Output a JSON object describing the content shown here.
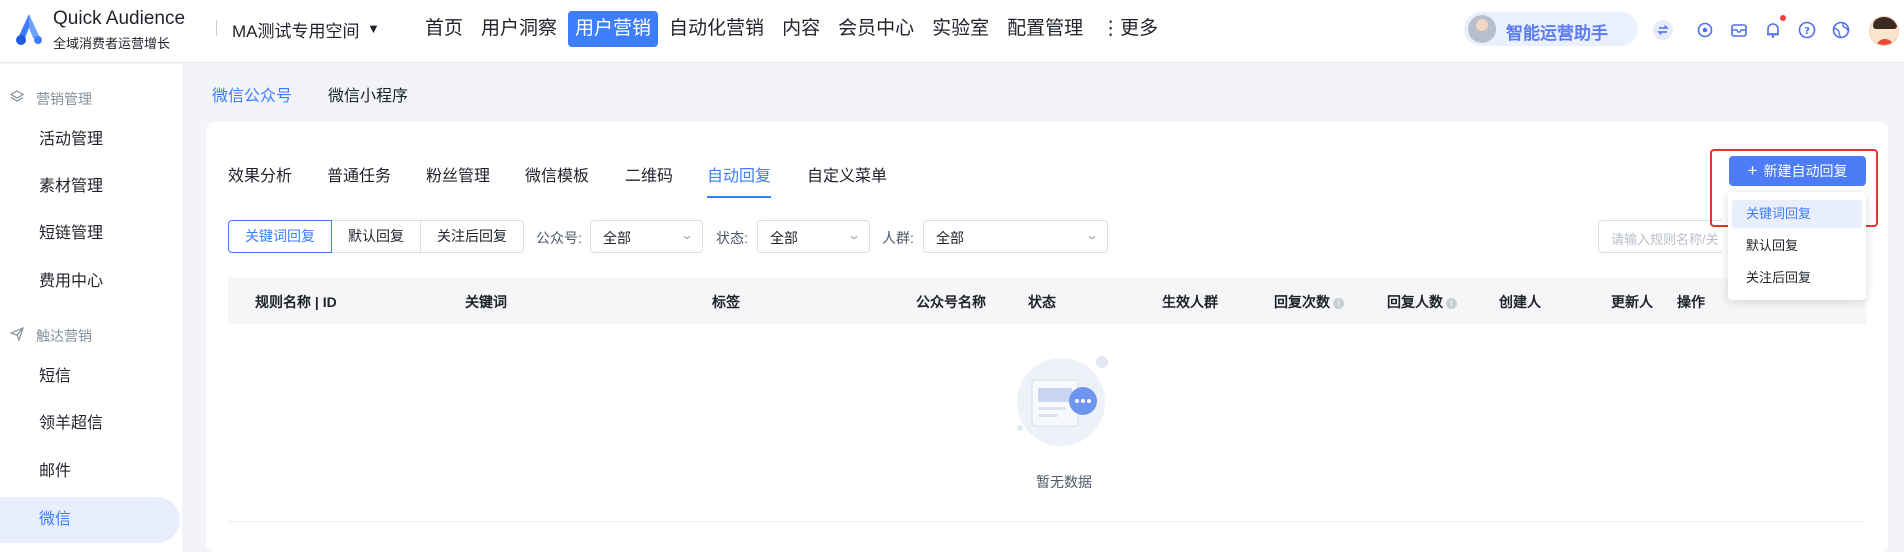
{
  "app": {
    "brand_name": "Quick Audience",
    "brand_subtitle": "全域消费者运营增长",
    "workspace": "MA测试专用空间"
  },
  "nav": {
    "items": [
      {
        "label": "首页",
        "active": false
      },
      {
        "label": "用户洞察",
        "active": false
      },
      {
        "label": "用户营销",
        "active": true
      },
      {
        "label": "自动化营销",
        "active": false
      },
      {
        "label": "内容",
        "active": false
      },
      {
        "label": "会员中心",
        "active": false
      },
      {
        "label": "实验室",
        "active": false
      },
      {
        "label": "配置管理",
        "active": false
      },
      {
        "label": "⋮更多",
        "active": false
      }
    ],
    "assistant_label": "智能运营助手"
  },
  "sidebar": {
    "groups": [
      {
        "label": "营销管理",
        "icon": "layers-icon"
      },
      {
        "label": "触达营销",
        "icon": "send-icon"
      }
    ],
    "items": [
      {
        "label": "活动管理"
      },
      {
        "label": "素材管理"
      },
      {
        "label": "短链管理"
      },
      {
        "label": "费用中心"
      },
      {
        "label": "短信"
      },
      {
        "label": "领羊超信"
      },
      {
        "label": "邮件"
      },
      {
        "label": "微信",
        "active": true
      }
    ]
  },
  "subnav": {
    "tabs": [
      {
        "label": "微信公众号",
        "active": true
      },
      {
        "label": "微信小程序",
        "active": false
      }
    ]
  },
  "main": {
    "tabs": [
      {
        "label": "效果分析"
      },
      {
        "label": "普通任务"
      },
      {
        "label": "粉丝管理"
      },
      {
        "label": "微信模板"
      },
      {
        "label": "二维码"
      },
      {
        "label": "自动回复",
        "active": true
      },
      {
        "label": "自定义菜单"
      }
    ],
    "reply_types": [
      {
        "label": "关键词回复",
        "active": true
      },
      {
        "label": "默认回复"
      },
      {
        "label": "关注后回复"
      }
    ],
    "filters": {
      "account_label": "公众号:",
      "account_value": "全部",
      "status_label": "状态:",
      "status_value": "全部",
      "audience_label": "人群:",
      "audience_value": "全部"
    },
    "search_placeholder": "请输入规则名称/关",
    "create_button": "新建自动回复",
    "create_menu": [
      {
        "label": "关键词回复",
        "active": true
      },
      {
        "label": "默认回复"
      },
      {
        "label": "关注后回复"
      }
    ],
    "table": {
      "columns": [
        "规则名称 | ID",
        "关键词",
        "标签",
        "公众号名称",
        "状态",
        "生效人群",
        "回复次数",
        "回复人数",
        "创建人",
        "更新人",
        "操作"
      ],
      "rows": [],
      "empty_text": "暂无数据"
    }
  },
  "colors": {
    "accent": "#3d7eff",
    "primary_button": "#4e7cf6",
    "highlight_box": "#e8332a"
  }
}
